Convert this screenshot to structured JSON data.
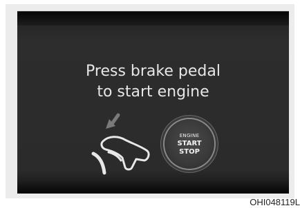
{
  "display": {
    "message_line1": "Press brake pedal",
    "message_line2": "to start engine"
  },
  "engine_button": {
    "line1": "ENGINE",
    "line2": "START",
    "line3": "STOP"
  },
  "figure_code": "OHI048119L",
  "icons": {
    "pedal": "brake-pedal-foot-icon",
    "arrow": "press-arrow-icon"
  },
  "colors": {
    "screen_bg": "#2b2b2b",
    "text": "#e6e6e6",
    "frame": "#ececec"
  }
}
